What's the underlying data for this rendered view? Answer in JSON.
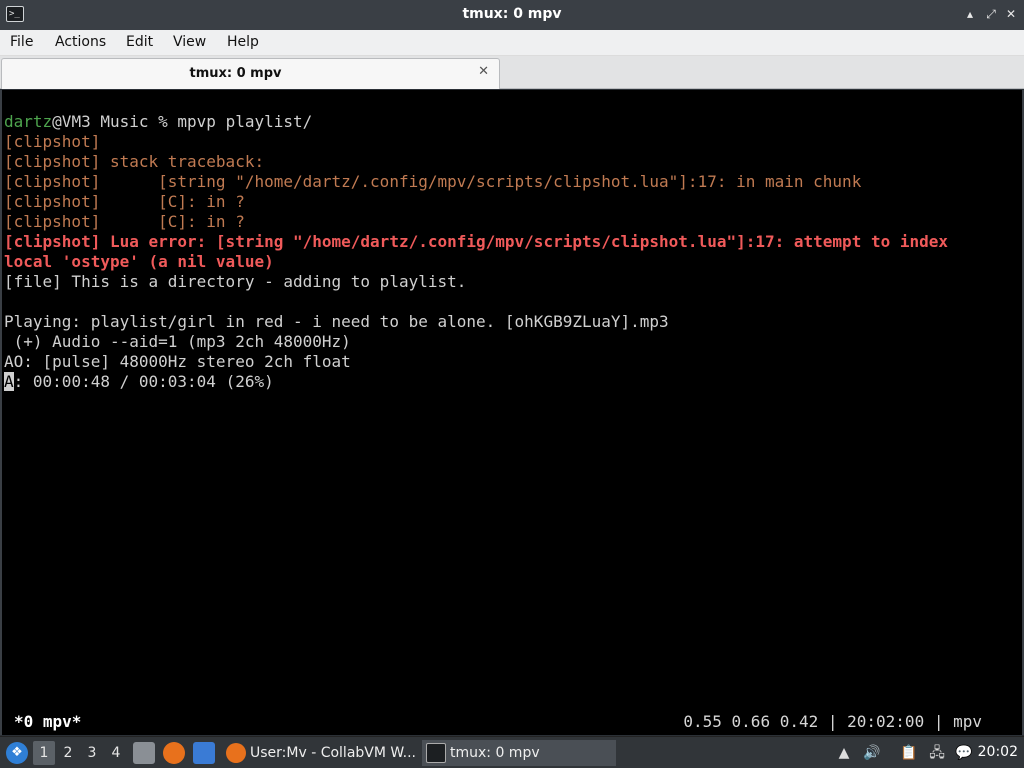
{
  "window": {
    "title": "tmux: 0 mpv",
    "minimize_glyph": "▴",
    "maximize_glyph": "⤢",
    "close_glyph": "✕"
  },
  "menu": [
    "File",
    "Actions",
    "Edit",
    "View",
    "Help"
  ],
  "tab": {
    "label": "tmux: 0 mpv",
    "close_glyph": "✕"
  },
  "terminal": {
    "prompt_user": "dartz",
    "prompt_rest": "@VM3 Music % mpvp playlist/",
    "lines": [
      "[clipshot]",
      "[clipshot] stack traceback:",
      "[clipshot]      [string \"/home/dartz/.config/mpv/scripts/clipshot.lua\"]:17: in main chunk",
      "[clipshot]      [C]: in ?",
      "[clipshot]      [C]: in ?"
    ],
    "error_line_1": "[clipshot] Lua error: [string \"/home/dartz/.config/mpv/scripts/clipshot.lua\"]:17: attempt to index",
    "error_line_2": "local 'ostype' (a nil value)",
    "file_line": "[file] This is a directory - adding to playlist.",
    "playing_line": "Playing: playlist/girl in red - i need to be alone. [ohKGB9ZLuaY].mp3",
    "audio_line": " (+) Audio --aid=1 (mp3 2ch 48000Hz)",
    "ao_line": "AO: [pulse] 48000Hz stereo 2ch float",
    "status_cursor": "A",
    "status_rest": ": 00:00:48 / 00:03:04 (26%)",
    "tmux_left": "*0 mpv*",
    "tmux_right": "0.55 0.66 0.42 | 20:02:00 | mpv"
  },
  "taskbar": {
    "workspaces": [
      "1",
      "2",
      "3",
      "4"
    ],
    "active_workspace": "1",
    "tasks": [
      {
        "label": "User:Mv - CollabVM W...",
        "icon": "firefox-icon"
      },
      {
        "label": "tmux: 0 mpv",
        "icon": "terminal-icon"
      }
    ],
    "clock": "20:02",
    "colors": {
      "start": "#2f7fd6",
      "firefox": "#e8711c"
    }
  }
}
